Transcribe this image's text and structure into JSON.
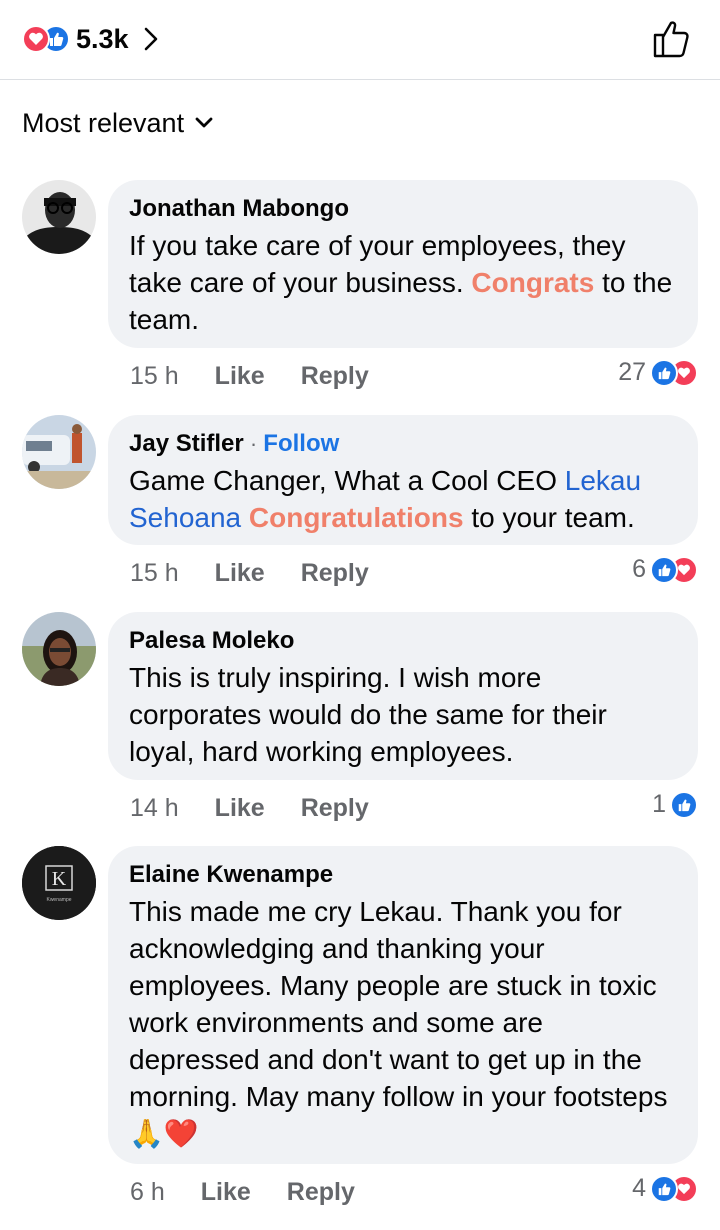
{
  "header": {
    "reaction_count": "5.3k"
  },
  "sort": {
    "label": "Most relevant"
  },
  "comments": [
    {
      "name": "Jonathan Mabongo",
      "follow": "",
      "text_parts": [
        "If you take care of your employees, they take care of your business. ",
        "Congrats",
        " to the team."
      ],
      "time": "15 h",
      "like": "Like",
      "reply": "Reply",
      "reactions": "27"
    },
    {
      "name": "Jay Stifler",
      "follow_sep": " · ",
      "follow": "Follow",
      "text_parts": [
        "Game Changer, What a Cool CEO ",
        "Lekau Sehoana",
        " ",
        "Congratulations",
        " to your team."
      ],
      "time": "15 h",
      "like": "Like",
      "reply": "Reply",
      "reactions": "6"
    },
    {
      "name": "Palesa Moleko",
      "text": "This is truly inspiring. I wish more corporates would do the same for their loyal, hard working employees.",
      "time": "14 h",
      "like": "Like",
      "reply": "Reply",
      "reactions": "1"
    },
    {
      "name": "Elaine Kwenampe",
      "text": "This made me cry Lekau. Thank you for acknowledging and thanking your employees. Many people are stuck in toxic work environments and some are depressed and don't want to get up in the morning. May many follow in your footsteps🙏❤️",
      "time": "6 h",
      "like": "Like",
      "reply": "Reply",
      "reactions": "4",
      "avatar_logo_letter": "K",
      "avatar_logo_text": "Kwenampe"
    }
  ],
  "colors": {
    "like_blue": "#1b74e4",
    "love_red": "#f33e58",
    "highlight": "#f0806a",
    "bubble_bg": "#f0f2f5",
    "meta_gray": "#65676b"
  },
  "icons": [
    "love-reaction-icon",
    "like-reaction-icon",
    "chevron-right-icon",
    "thumbs-up-icon",
    "chevron-down-icon"
  ]
}
